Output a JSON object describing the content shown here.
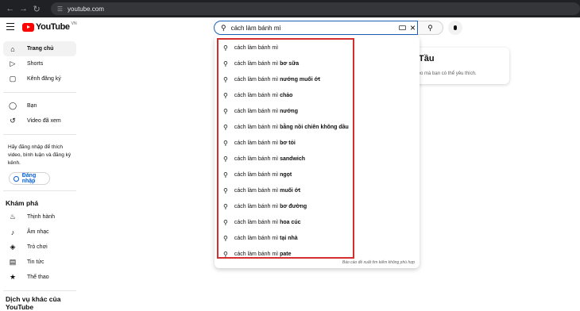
{
  "browser": {
    "url": "youtube.com"
  },
  "header": {
    "logo_text": "YouTube",
    "country": "VN",
    "search_value": "cách làm bánh mì"
  },
  "sidebar": {
    "main_items": [
      {
        "label": "Trang chủ",
        "icon": "home-icon"
      },
      {
        "label": "Shorts",
        "icon": "shorts-icon"
      },
      {
        "label": "Kênh đăng ký",
        "icon": "subscriptions-icon"
      }
    ],
    "you_items": [
      {
        "label": "Bạn",
        "icon": "user-icon"
      },
      {
        "label": "Video đã xem",
        "icon": "history-icon"
      }
    ],
    "login_prompt": "Hãy đăng nhập để thích video, bình luận và đăng ký kênh.",
    "login_button": "Đăng nhập",
    "explore_heading": "Khám phá",
    "explore_items": [
      {
        "label": "Thịnh hành",
        "icon": "fire-icon"
      },
      {
        "label": "Âm nhạc",
        "icon": "music-icon"
      },
      {
        "label": "Trò chơi",
        "icon": "gamepad-icon"
      },
      {
        "label": "Tin tức",
        "icon": "news-icon"
      },
      {
        "label": "Thể thao",
        "icon": "trophy-icon"
      }
    ],
    "more_heading": "Dịch vụ khác của YouTube"
  },
  "main": {
    "card_title": "Tầu",
    "card_sub": "g video mà bạn có thể yêu thích."
  },
  "suggestions": [
    {
      "base": "cách làm bánh mì",
      "suffix": ""
    },
    {
      "base": "cách làm bánh mì",
      "suffix": "bơ sữa"
    },
    {
      "base": "cách làm bánh mì",
      "suffix": "nướng muối ớt"
    },
    {
      "base": "cách làm bánh mì",
      "suffix": "chảo"
    },
    {
      "base": "cách làm bánh mì",
      "suffix": "nướng"
    },
    {
      "base": "cách làm bánh mì",
      "suffix": "bằng nồi chiên không dầu"
    },
    {
      "base": "cách làm bánh mì",
      "suffix": "bơ tỏi"
    },
    {
      "base": "cách làm bánh mì",
      "suffix": "sandwich"
    },
    {
      "base": "cách làm bánh mì",
      "suffix": "ngọt"
    },
    {
      "base": "cách làm bánh mì",
      "suffix": "muối ớt"
    },
    {
      "base": "cách làm bánh mì",
      "suffix": "bơ đường"
    },
    {
      "base": "cách làm bánh mì",
      "suffix": "hoa cúc"
    },
    {
      "base": "cách làm bánh mì",
      "suffix": "tại nhà"
    },
    {
      "base": "cách làm bánh mì",
      "suffix": "pate"
    }
  ],
  "report_text": "Báo cáo đề xuất tìm kiếm không phù hợp"
}
